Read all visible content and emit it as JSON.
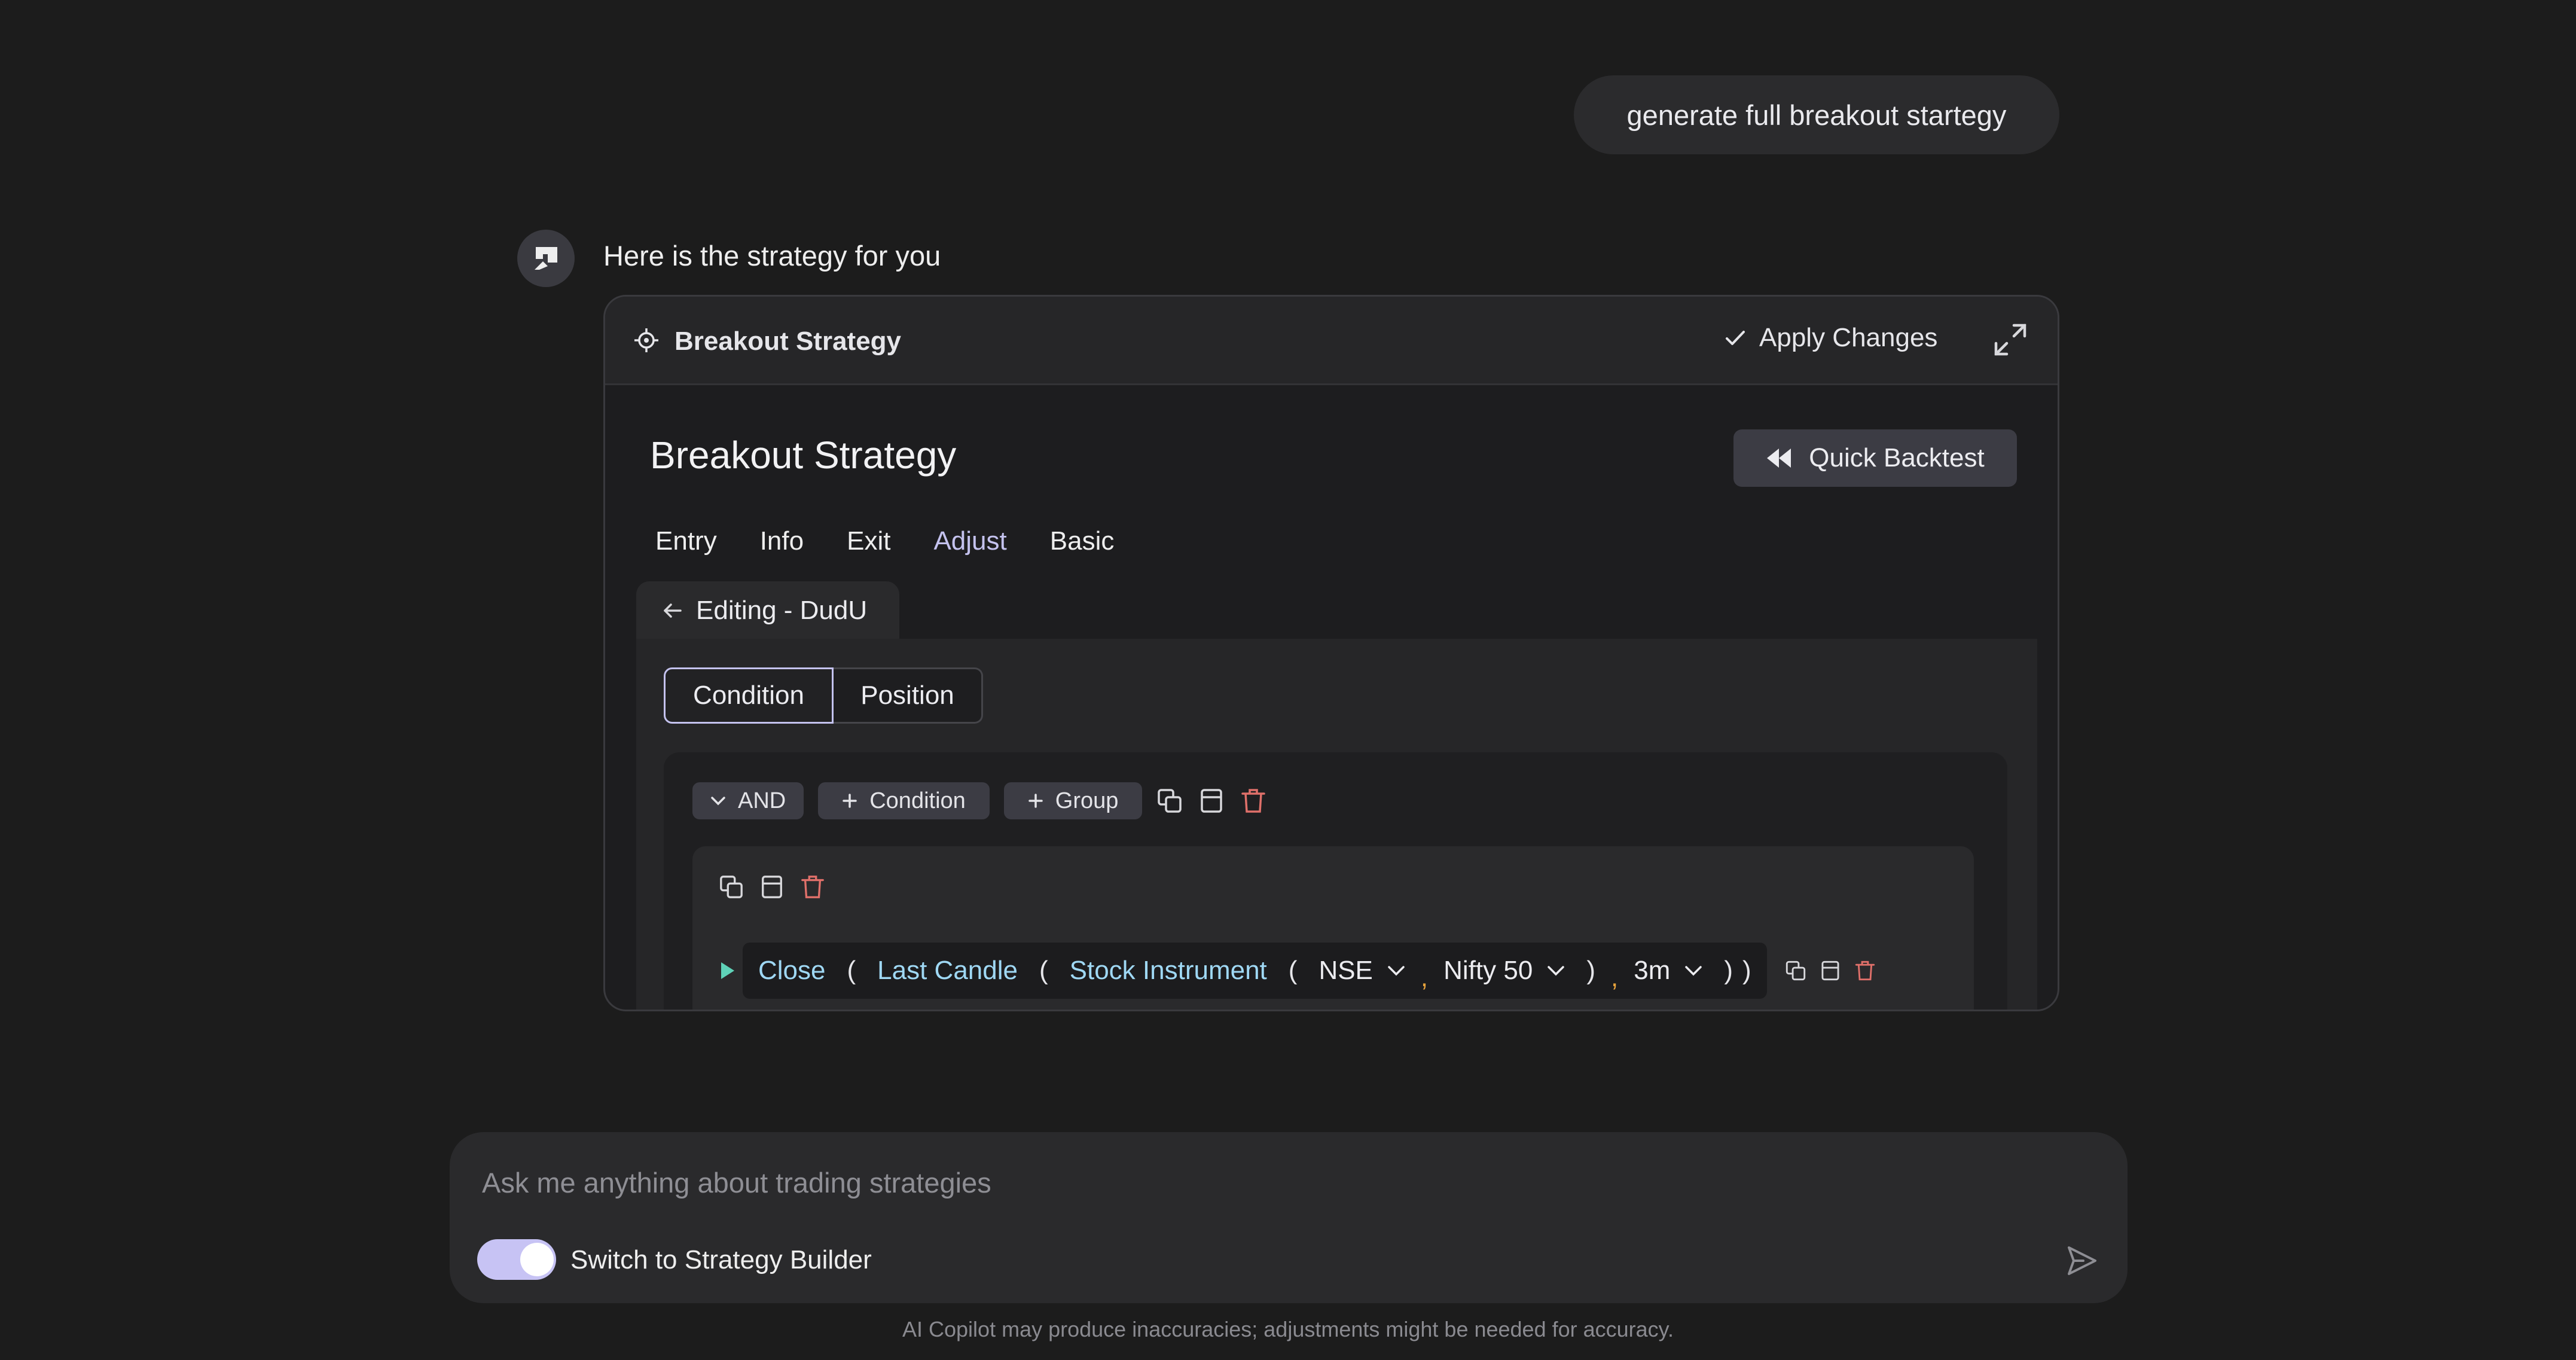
{
  "chat": {
    "user_message": "generate full breakout startegy",
    "bot_message": "Here is the strategy for you"
  },
  "card": {
    "header_title": "Breakout Strategy",
    "apply_label": "Apply Changes",
    "strategy_title": "Breakout Strategy",
    "quick_backtest_label": "Quick Backtest",
    "tabs": [
      "Entry",
      "Info",
      "Exit",
      "Adjust",
      "Basic"
    ],
    "active_tab": "Adjust",
    "editing_label": "Editing - DudU",
    "segments": [
      "Condition",
      "Position"
    ],
    "toolbar": {
      "and_label": "AND",
      "condition_label": "Condition",
      "group_label": "Group"
    },
    "expression": {
      "close": "Close",
      "last_candle": "Last Candle",
      "stock_instrument": "Stock Instrument",
      "exchange": "NSE",
      "instrument": "Nifty 50",
      "timeframe": "3m",
      "open_paren": "(",
      "close_paren": ")",
      "comma": ","
    }
  },
  "composer": {
    "placeholder": "Ask me anything about trading strategies",
    "toggle_label": "Switch to Strategy Builder",
    "toggle_on": true
  },
  "disclaimer": "AI Copilot may produce inaccuracies; adjustments might be needed for accuracy.",
  "colors": {
    "accent": "#c4c2ee",
    "keyword": "#9fd8f4",
    "delete": "#e0706a",
    "toggle": "#c7c3f4"
  },
  "icons": {
    "avatar": "bot-logo-icon",
    "header": "crosshair-icon",
    "apply": "check-icon",
    "expand": "expand-icon",
    "backtest": "rewind-icon",
    "back": "arrow-left-icon",
    "copy": "copy-icon",
    "save": "save-icon",
    "delete": "trash-icon",
    "send": "send-icon"
  }
}
